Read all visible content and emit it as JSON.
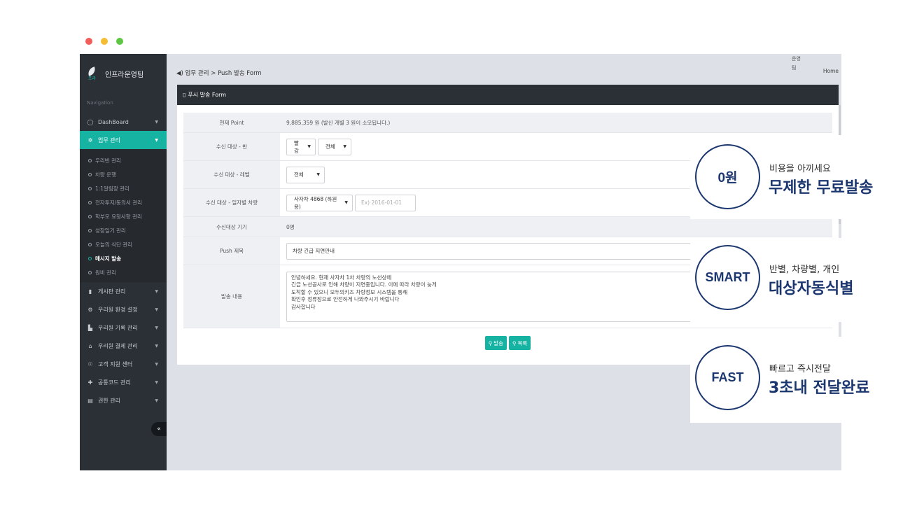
{
  "window_controls": {
    "colors": [
      "#f25c59",
      "#f5bd32",
      "#5ec643"
    ]
  },
  "sidebar": {
    "brand_logo_text": "프라",
    "brand_name": "인프라운영팀",
    "nav_caption": "Navigation",
    "items": [
      {
        "label": "DashBoard",
        "icon": "chat-bubble-icon"
      },
      {
        "label": "업무 관리",
        "icon": "gear-icon",
        "active": true
      }
    ],
    "sub_items": [
      {
        "label": "우리반 관리"
      },
      {
        "label": "차량 운행"
      },
      {
        "label": "1:1알림장 관리"
      },
      {
        "label": "전자투지/동의서 관리"
      },
      {
        "label": "학부모 요청사항 관리"
      },
      {
        "label": "성장일기 관리"
      },
      {
        "label": "오늘의 식단 관리"
      },
      {
        "label": "메시지 발송",
        "current": true
      },
      {
        "label": "원비 관리"
      }
    ],
    "items_bottom": [
      {
        "label": "게시판 관리",
        "icon": "book-icon"
      },
      {
        "label": "우리원 환경 설정",
        "icon": "cogs-icon"
      },
      {
        "label": "우리원 기록 관리",
        "icon": "bar-chart-icon"
      },
      {
        "label": "우리원 결제 관리",
        "icon": "bank-icon"
      },
      {
        "label": "고객 지원 센터",
        "icon": "support-icon"
      },
      {
        "label": "공통코드 관리",
        "icon": "gift-icon"
      },
      {
        "label": "권한 관리",
        "icon": "archive-icon"
      }
    ],
    "collapse_glyph": "«"
  },
  "topbar": {
    "breadcrumb": "◀) 업무 관리 > Push 발송 Form",
    "right_line1": "운영",
    "right_line2": "팀",
    "home": "Home"
  },
  "panel": {
    "title": "푸시 발송 Form",
    "rows": {
      "point_label": "현재 Point",
      "point_value": "9,885,359 원 (발신 개별 3 원이 소모됩니다.)",
      "class_label": "수신 대상 - 반",
      "class_select1": "빨강",
      "class_select2": "전체",
      "level_label": "수신 대상 - 레벨",
      "level_select": "전체",
      "vehicle_label": "수신 대상 - 일자별 차량",
      "vehicle_select": "사자차 4868 (하원용)",
      "date_placeholder": "Ex) 2016-01-01",
      "device_label": "수신대상 기기",
      "device_value": "0명",
      "push_title_label": "Push 제목",
      "push_title_value": "차량 긴급 지연안내",
      "content_label": "발송 내용",
      "content_lines": [
        "안녕하세요. 현재 사자차 1차 차량의 노선상에",
        "긴급 노선공사로 인해 차량이 지연중입니다. 이에 따라 차량이 늦게",
        "도착할 수 있으니 모두의키즈 차량정보 시스템을 통해",
        "확인후 정류장으로 안전하게 나와주시기 바랍니다",
        "감사합니다"
      ]
    },
    "buttons": {
      "send": "발송",
      "list": "목록"
    }
  },
  "cards": [
    {
      "circle": "0원",
      "subtitle": "비용을 아끼세요",
      "title": "무제한 무료발송"
    },
    {
      "circle": "SMART",
      "subtitle": "반별, 차량별, 개인",
      "title": "대상자동식별"
    },
    {
      "circle": "FAST",
      "subtitle": "빠르고 즉시전달",
      "title": "3초내 전달완료"
    }
  ]
}
